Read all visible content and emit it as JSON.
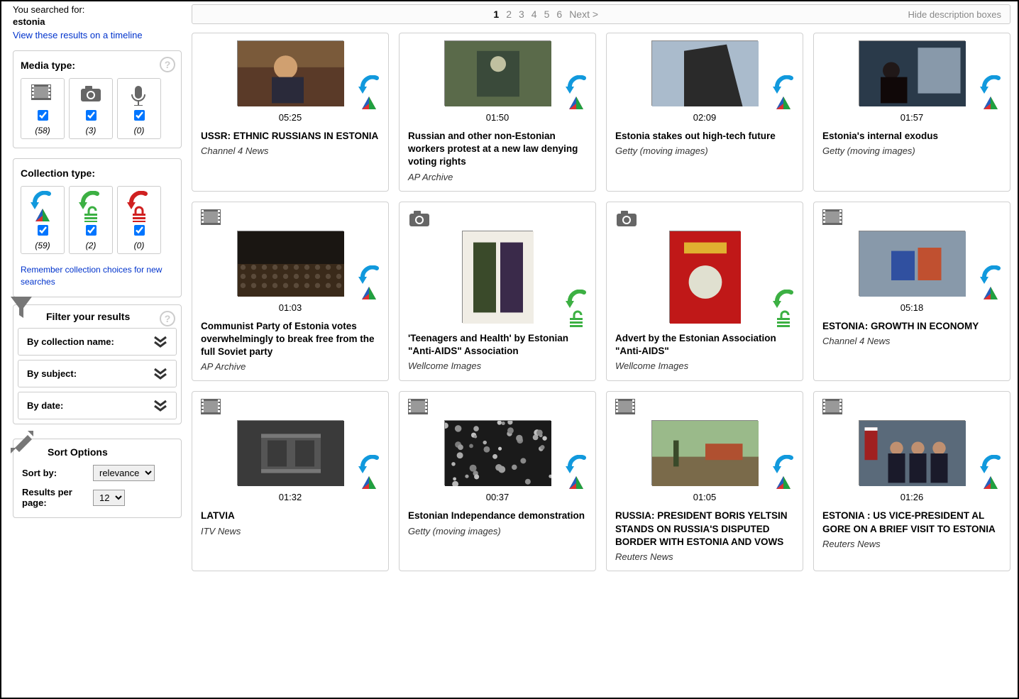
{
  "search": {
    "label": "You searched for:",
    "term": "estonia",
    "timeline_link": "View these results on a timeline"
  },
  "media_type": {
    "heading": "Media type:",
    "items": [
      {
        "icon": "film",
        "count": "(58)",
        "checked": true
      },
      {
        "icon": "camera",
        "count": "(3)",
        "checked": true
      },
      {
        "icon": "microphone",
        "count": "(0)",
        "checked": true
      }
    ]
  },
  "collection_type": {
    "heading": "Collection type:",
    "items": [
      {
        "icon": "blue-arrow-tri",
        "count": "(59)",
        "checked": true
      },
      {
        "icon": "green-arrow-lock",
        "count": "(2)",
        "checked": true
      },
      {
        "icon": "red-arrow-lock",
        "count": "(0)",
        "checked": true
      }
    ],
    "remember_link": "Remember collection choices for new searches"
  },
  "filter": {
    "heading": "Filter your results",
    "rows": [
      "By collection name:",
      "By subject:",
      "By date:"
    ]
  },
  "sort": {
    "heading": "Sort Options",
    "sort_by_label": "Sort by:",
    "sort_by_value": "relevance",
    "per_page_label": "Results per page:",
    "per_page_value": "12"
  },
  "topbar": {
    "pages": [
      "1",
      "2",
      "3",
      "4",
      "5",
      "6"
    ],
    "next": "Next >",
    "hide_desc": "Hide description boxes"
  },
  "results": [
    {
      "type": "film",
      "badge": "blue",
      "duration": "05:25",
      "title": "USSR: ETHNIC RUSSIANS IN ESTONIA",
      "source": "Channel 4 News",
      "thumb": "man-desk",
      "show_type_icon": false
    },
    {
      "type": "film",
      "badge": "blue",
      "duration": "01:50",
      "title": "Russian and other non-Estonian workers protest at a new law denying voting rights",
      "source": "AP Archive",
      "thumb": "clock-building",
      "show_type_icon": false
    },
    {
      "type": "film",
      "badge": "blue",
      "duration": "02:09",
      "title": "Estonia stakes out high-tech future",
      "source": "Getty (moving images)",
      "thumb": "building-sky",
      "show_type_icon": false
    },
    {
      "type": "film",
      "badge": "blue",
      "duration": "01:57",
      "title": "Estonia's internal exodus",
      "source": "Getty (moving images)",
      "thumb": "woman-window",
      "show_type_icon": false
    },
    {
      "type": "film",
      "badge": "blue",
      "duration": "01:03",
      "title": "Communist Party of Estonia votes overwhelmingly to break free from the full Soviet party",
      "source": "AP Archive",
      "thumb": "crowd-hall",
      "show_type_icon": true
    },
    {
      "type": "camera",
      "badge": "green",
      "duration": "",
      "title": "'Teenagers and Health' by Estonian \"Anti-AIDS\" Association",
      "source": "Wellcome Images",
      "thumb": "book-figures",
      "show_type_icon": true
    },
    {
      "type": "camera",
      "badge": "green",
      "duration": "",
      "title": "Advert by the Estonian Association \"Anti-AIDS\"",
      "source": "Wellcome Images",
      "thumb": "red-poster",
      "show_type_icon": true
    },
    {
      "type": "film",
      "badge": "blue",
      "duration": "05:18",
      "title": "ESTONIA: GROWTH IN ECONOMY",
      "source": "Channel 4 News",
      "thumb": "shelf-boxes",
      "show_type_icon": true
    },
    {
      "type": "film",
      "badge": "blue",
      "duration": "01:32",
      "title": "LATVIA",
      "source": "ITV News",
      "thumb": "placeholder",
      "show_type_icon": true
    },
    {
      "type": "film",
      "badge": "blue",
      "duration": "00:37",
      "title": "Estonian Independance demonstration",
      "source": "Getty (moving images)",
      "thumb": "bw-crowd",
      "show_type_icon": true
    },
    {
      "type": "film",
      "badge": "blue",
      "duration": "01:05",
      "title": "RUSSIA: PRESIDENT BORIS YELTSIN STANDS ON RUSSIA'S DISPUTED BORDER WITH ESTONIA AND VOWS",
      "source": "Reuters News",
      "thumb": "border-fence",
      "show_type_icon": true
    },
    {
      "type": "film",
      "badge": "blue",
      "duration": "01:26",
      "title": "ESTONIA : US VICE-PRESIDENT AL GORE ON A BRIEF VISIT TO ESTONIA",
      "source": "Reuters News",
      "thumb": "flags-men",
      "show_type_icon": true
    }
  ]
}
